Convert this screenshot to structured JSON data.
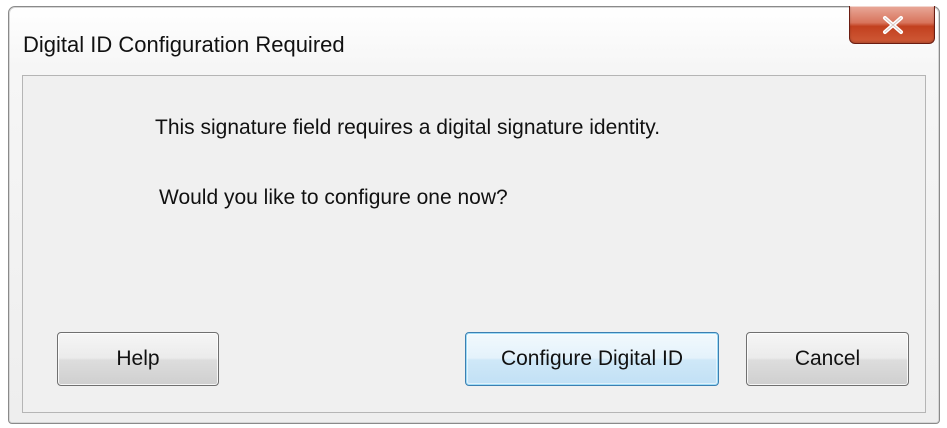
{
  "window": {
    "title": "Digital ID Configuration Required",
    "close_icon": "close-icon"
  },
  "message": {
    "line1": "This signature field requires a digital signature identity.",
    "line2": "Would you like to configure one now?"
  },
  "buttons": {
    "help": "Help",
    "configure": "Configure Digital ID",
    "cancel": "Cancel"
  },
  "colors": {
    "close_button": "#c7462a",
    "default_button_border": "#3c7fb1",
    "dialog_background": "#f0f0f0"
  }
}
